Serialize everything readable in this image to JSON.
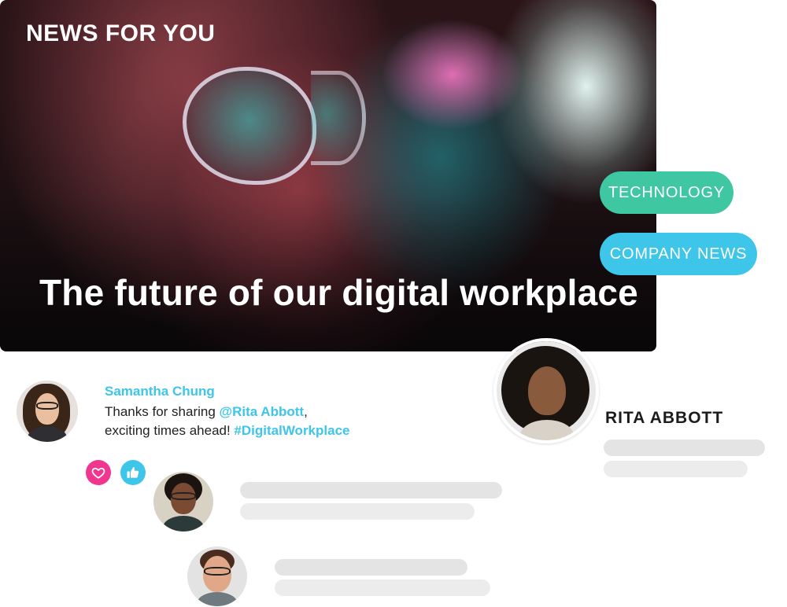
{
  "hero": {
    "kicker": "NEWS FOR YOU",
    "title": "The future of our digital workplace"
  },
  "tags": [
    {
      "label": "TECHNOLOGY",
      "color": "#3fc7a2"
    },
    {
      "label": "COMPANY NEWS",
      "color": "#3ec5ea"
    }
  ],
  "author": {
    "name": "RITA ABBOTT"
  },
  "comment": {
    "author": "Samantha Chung",
    "text_prefix": "Thanks for sharing ",
    "mention": "@Rita Abbott",
    "text_middle": ",",
    "text_line2": "exciting times ahead! ",
    "hashtag": "#DigitalWorkplace"
  },
  "reactions": [
    {
      "icon": "heart-icon",
      "color": "#f0368f"
    },
    {
      "icon": "thumbs-up-icon",
      "color": "#3ec5ea"
    }
  ],
  "colors": {
    "accent_blue": "#3ec5ea",
    "accent_green": "#3fc7a2",
    "accent_pink": "#f0368f",
    "placeholder": "#e4e4e4"
  }
}
